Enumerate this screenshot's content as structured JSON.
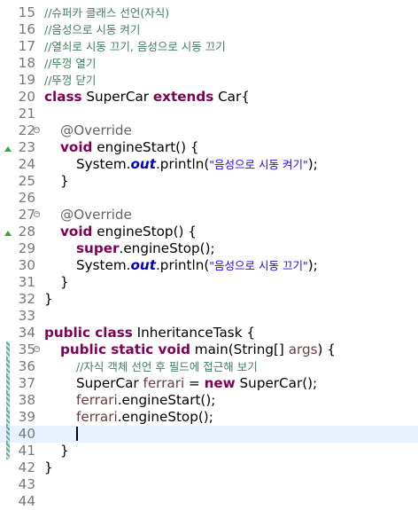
{
  "editor": {
    "lines": [
      {
        "num": "15",
        "text": "//슈퍼카 클래스 선언(자식)"
      },
      {
        "num": "16",
        "text": "//음성으로 시동 켜기"
      },
      {
        "num": "17",
        "text": "//열쇠로 시동 끄기, 음성으로 시동 끄기"
      },
      {
        "num": "18",
        "text": "//뚜껑 열기"
      },
      {
        "num": "19",
        "text": "//뚜껑 닫기"
      },
      {
        "num": "20",
        "kw1": "class",
        "t1": " SuperCar ",
        "kw2": "extends",
        "t2": " Car{"
      },
      {
        "num": "21"
      },
      {
        "num": "22",
        "text": "@Override"
      },
      {
        "num": "23",
        "kw": "void",
        "t": " engineStart() {"
      },
      {
        "num": "24",
        "t1": "System.",
        "field": "out",
        "t2": ".println(",
        "str": "\"음성으로 시동 켜기\"",
        "t3": ");"
      },
      {
        "num": "25",
        "text": "}"
      },
      {
        "num": "26"
      },
      {
        "num": "27",
        "text": "@Override"
      },
      {
        "num": "28",
        "kw": "void",
        "t": " engineStop() {"
      },
      {
        "num": "29",
        "kw": "super",
        "t": ".engineStop();"
      },
      {
        "num": "30",
        "t1": "System.",
        "field": "out",
        "t2": ".println(",
        "str": "\"음성으로 시동 끄기\"",
        "t3": ");"
      },
      {
        "num": "31",
        "text": "}"
      },
      {
        "num": "32",
        "text": "}"
      },
      {
        "num": "33"
      },
      {
        "num": "34",
        "kw": "public class",
        "t": " InheritanceTask {"
      },
      {
        "num": "35",
        "kw": "public static void",
        "t1": " main(String[] ",
        "var": "args",
        "t2": ") {"
      },
      {
        "num": "36",
        "text": "//자식 객체 선언 후 필드에 접근해 보기"
      },
      {
        "num": "37",
        "t1": "SuperCar ",
        "var": "ferrari",
        "t2": " = ",
        "kw": "new",
        "t3": " SuperCar();"
      },
      {
        "num": "38",
        "var": "ferrari",
        "t": ".engineStart();"
      },
      {
        "num": "39",
        "var": "ferrari",
        "t": ".engineStop();"
      },
      {
        "num": "40"
      },
      {
        "num": "41",
        "text": "}"
      },
      {
        "num": "42",
        "text": "}"
      },
      {
        "num": "43"
      },
      {
        "num": "44"
      }
    ]
  }
}
